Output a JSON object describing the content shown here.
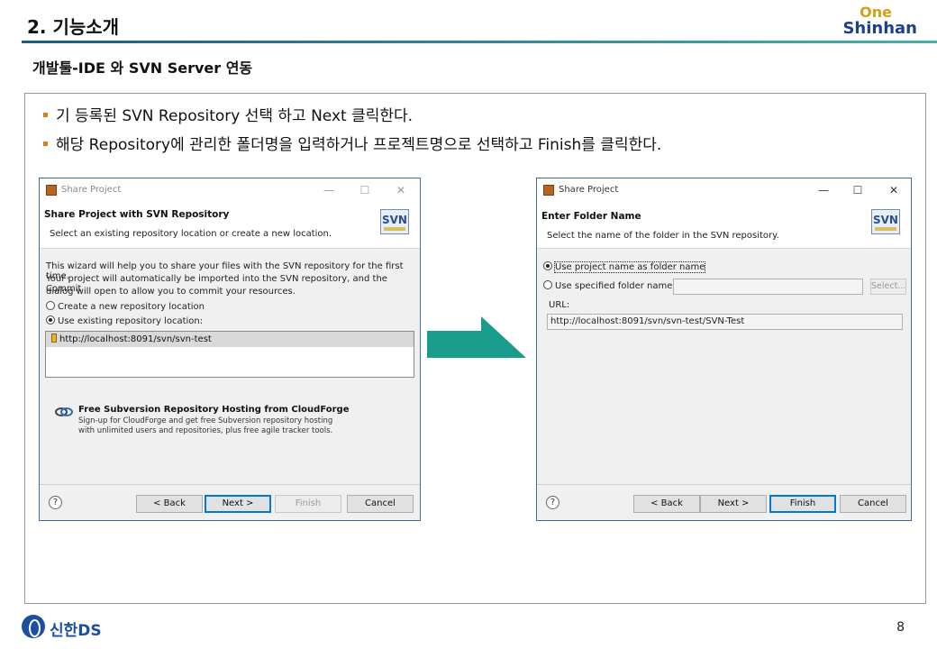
{
  "slide": {
    "title": "2. 기능소개",
    "logo_top": "One",
    "logo_bottom": "Shinhan",
    "subtitle": "개발툴-IDE 와 SVN Server 연동",
    "bullets": [
      "기 등록된 SVN Repository 선택 하고 Next 클릭한다.",
      "해당 Repository에 관리한 폴더명을 입력하거나 프로젝트명으로 선택하고 Finish를 클릭한다."
    ],
    "footer_brand": "신한DS",
    "page_number": "8"
  },
  "dialog1": {
    "window_title": "Share Project",
    "header_title": "Share Project with SVN Repository",
    "header_desc": "Select an existing repository location or create a new location.",
    "badge": "SVN",
    "intro_lines": [
      "This wizard will help you to share your files with the SVN repository for the first time.",
      "Your project will automatically be imported into the SVN repository, and the Commit",
      "dialog will open to allow you to commit your resources."
    ],
    "radio_create": "Create a new repository location",
    "radio_existing": "Use existing repository location:",
    "radio_selected": "existing",
    "repositories": [
      "http://localhost:8091/svn/svn-test"
    ],
    "cloudforge_title": "Free Subversion Repository Hosting from CloudForge",
    "cloudforge_desc_lines": [
      "Sign-up for CloudForge and get free Subversion repository hosting",
      "with unlimited users and repositories, plus free agile tracker tools."
    ],
    "buttons": {
      "back": "< Back",
      "next": "Next >",
      "finish": "Finish",
      "cancel": "Cancel"
    },
    "help": "?"
  },
  "dialog2": {
    "window_title": "Share Project",
    "header_title": "Enter Folder Name",
    "header_desc": "Select the name of the folder in the SVN repository.",
    "badge": "SVN",
    "radio_project_name": "Use project name as folder name",
    "radio_specified": "Use specified folder name:",
    "radio_selected": "project_name",
    "folder_name_value": "",
    "select_button": "Select...",
    "url_label": "URL:",
    "url_value": "http://localhost:8091/svn/svn-test/SVN-Test",
    "buttons": {
      "back": "< Back",
      "next": "Next >",
      "finish": "Finish",
      "cancel": "Cancel"
    },
    "help": "?"
  },
  "colors": {
    "accent_teal": "#1a9c8c",
    "bullet_orange": "#e07a1a",
    "brand_blue": "#1c4fa0"
  }
}
